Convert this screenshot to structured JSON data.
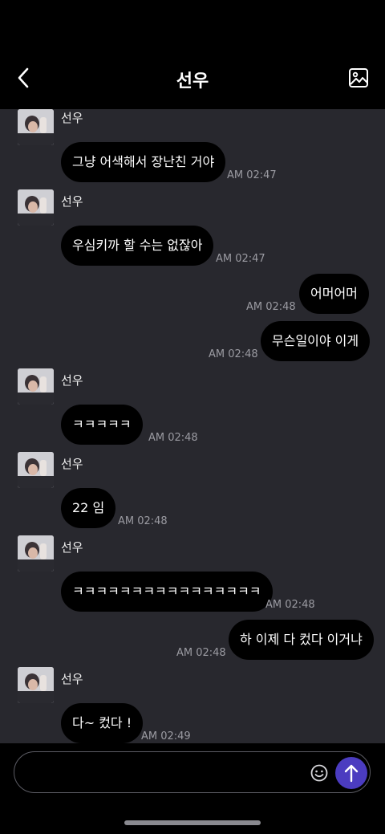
{
  "header": {
    "title": "선우",
    "back_icon": "chevron-left-icon",
    "gallery_icon": "image-icon"
  },
  "messages": [
    {
      "from": "other",
      "sender": "선우",
      "text": "그냥 어색해서 장난친 거야",
      "time": "AM 02:47"
    },
    {
      "from": "other",
      "sender": "선우",
      "text": "우심키까 할 수는 없잖아",
      "time": "AM 02:47"
    },
    {
      "from": "me",
      "text": "어머어머",
      "time": "AM 02:48"
    },
    {
      "from": "me",
      "text": "무슨일이야 이게",
      "time": "AM 02:48"
    },
    {
      "from": "other",
      "sender": "선우",
      "text": "ㅋㅋㅋㅋㅋ",
      "time": "AM 02:48"
    },
    {
      "from": "other",
      "sender": "선우",
      "text": "22 임",
      "time": "AM 02:48"
    },
    {
      "from": "other",
      "sender": "선우",
      "text": "ㅋㅋㅋㅋㅋㅋㅋㅋㅋㅋㅋㅋㅋㅋㅋㅋ",
      "time": "AM 02:48"
    },
    {
      "from": "me",
      "text": "하 이제 다 컸다 이거냐",
      "time": "AM 02:48"
    },
    {
      "from": "other",
      "sender": "선우",
      "text": "다~ 컸다 !",
      "time": "AM 02:49"
    }
  ],
  "composer": {
    "value": "",
    "placeholder": "",
    "emoji_icon": "smiley-icon",
    "send_icon": "arrow-up-icon",
    "send_color": "#4b3cc0"
  },
  "colors": {
    "chat_bg": "#28282e",
    "bubble_bg": "#000000",
    "time_text": "#9b9ba2"
  }
}
